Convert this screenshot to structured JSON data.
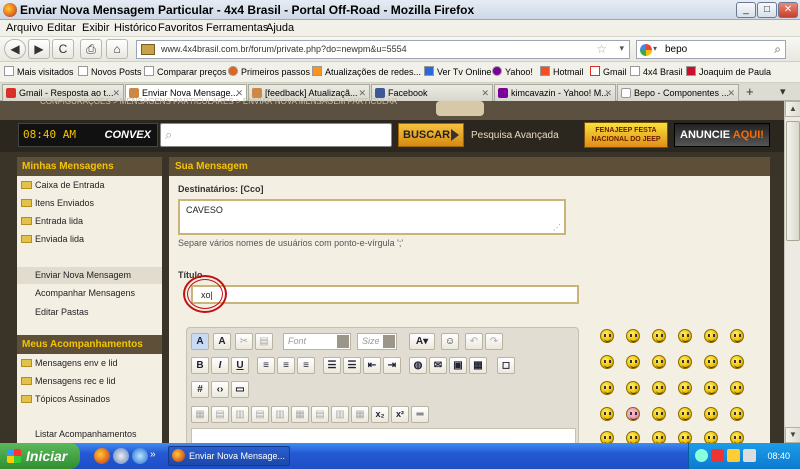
{
  "window": {
    "title": "Enviar Nova Mensagem Particular - 4x4 Brasil - Portal Off-Road - Mozilla Firefox",
    "min": "_",
    "max": "□",
    "close": "✕"
  },
  "menu": [
    "Arquivo",
    "Editar",
    "Exibir",
    "Histórico",
    "Favoritos",
    "Ferramentas",
    "Ajuda"
  ],
  "nav": {
    "url": "www.4x4brasil.com.br/forum/private.php?do=newpm&u=5554",
    "search_value": "bepo",
    "back": "◀",
    "forward": "▶",
    "reload": "C",
    "print": "⎙",
    "home": "⌂"
  },
  "bookmarks": [
    "Mais visitados",
    "Novos Posts",
    "Comparar preços",
    "Primeiros passos",
    "Atualizações de redes...",
    "Ver Tv Online",
    "Yahoo!",
    "Hotmail",
    "Gmail",
    "4x4 Brasil",
    "Joaquim de Paula"
  ],
  "tabs": [
    {
      "label": "Gmail - Resposta ao t...",
      "active": false
    },
    {
      "label": "Enviar Nova Mensage...",
      "active": true
    },
    {
      "label": "[feedback] Atualizaçã...",
      "active": false
    },
    {
      "label": "Facebook",
      "active": false
    },
    {
      "label": "kimcavazin - Yahoo! M...",
      "active": false
    },
    {
      "label": "Bepo - Componentes ...",
      "active": false
    }
  ],
  "tabbar": {
    "new_tab": "+",
    "list": "▾"
  },
  "site": {
    "breadcrumb": "CONFIGURAÇÕES  >  MENSAGENS PARTICULARES  >  ENVIAR NOVA MENSAGEM PARTICULAR",
    "clock": "08:40 AM",
    "convex": "CONVEX",
    "search_button": "BUSCAR",
    "advanced_search": "Pesquisa Avançada",
    "fenajeep": "FENAJEEP FESTA NACIONAL DO JEEP",
    "anuncie": "ANUNCIE",
    "anuncie_accent": "AQUI!"
  },
  "sidebar": {
    "section1": "Minhas Mensagens",
    "folders": [
      "Caixa de Entrada",
      "Itens Enviados",
      "Entrada lida",
      "Enviada lida"
    ],
    "actions": [
      "Enviar Nova Mensagem",
      "Acompanhar Mensagens",
      "Editar Pastas"
    ],
    "section2": "Meus Acompanhamentos",
    "follow_folders": [
      "Mensagens env e lid",
      "Mensagens rec e lid",
      "Tópicos Assinados"
    ],
    "list_link": "Listar Acompanhamentos"
  },
  "form": {
    "header": "Sua Mensagem",
    "recipients_label": "Destinatários: [Cco]",
    "recipients_value": "CAVESO",
    "recipients_help": "Separe vários nomes de usuários com ponto-e-vírgula ';'",
    "title_label": "Título",
    "title_value": "xo|",
    "font_placeholder": "Font",
    "size_placeholder": "Size"
  },
  "taskbar": {
    "start": "Iniciar",
    "app": "Enviar Nova Mensage...",
    "time": "08:40"
  },
  "scrollbar": {
    "up": "▲",
    "down": "▼"
  }
}
